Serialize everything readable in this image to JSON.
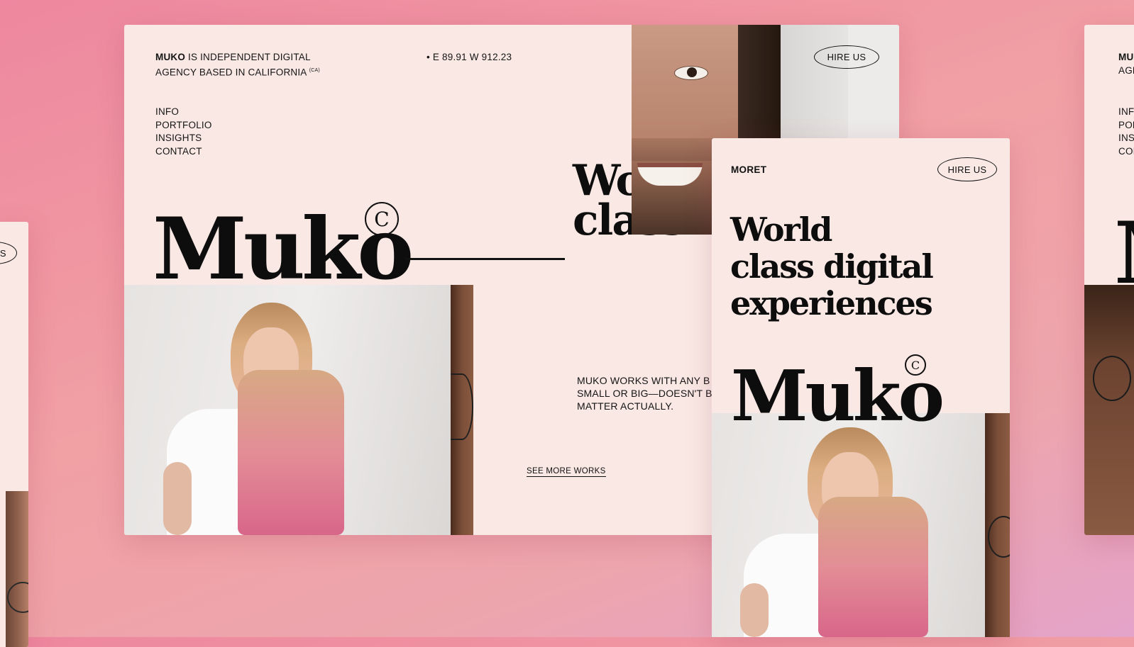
{
  "main": {
    "brand": "MUKO",
    "tagline_rest": " IS INDEPENDENT DIGITAL",
    "tagline_line2": "AGENCY BASED IN CALIFORNIA",
    "tagline_sup": "(CA)",
    "coords": "• E 89.91 W 912.23",
    "hire_label": "HIRE US",
    "nav": [
      "INFO",
      "PORTFOLIO",
      "INSIGHTS",
      "CONTACT"
    ],
    "logo": "Muko",
    "copyright_symbol": "C",
    "headline_line1": "Wo",
    "headline_line2": "class",
    "body_lines": [
      "MUKO WORKS WITH ANY B",
      "SMALL OR BIG—DOESN'T B",
      "MATTER ACTUALLY."
    ],
    "see_more": "SEE MORE WORKS"
  },
  "mobile": {
    "brand": "MORET",
    "hire_label": "HIRE US",
    "headline_lines": [
      "World",
      "class digital",
      "experiences"
    ],
    "logo": "Muko",
    "copyright_symbol": "C"
  },
  "left_panel": {
    "hire_fragment": "JS"
  },
  "right_panel": {
    "brand_fragment": "MU",
    "tagline_fragment": "AGE",
    "nav_fragments": [
      "INF",
      "POR",
      "INS",
      "COI"
    ],
    "logo_fragment": "M"
  },
  "colors": {
    "background_gradient": [
      "#ee879f",
      "#e4a3c9"
    ],
    "panel": "#f9e8e4",
    "ink": "#0d0d0d"
  }
}
